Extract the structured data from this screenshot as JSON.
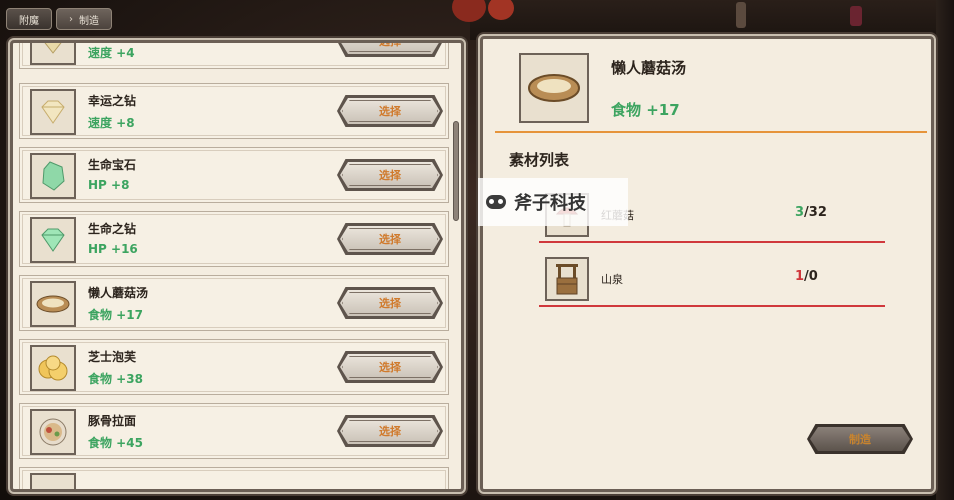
{
  "tabs": [
    {
      "label": "附魔",
      "active": false
    },
    {
      "label": "制造",
      "active": true
    }
  ],
  "list": {
    "items": [
      {
        "name": "",
        "stat": "速度 +4",
        "icon": "gem-icon",
        "select_label": "选择"
      },
      {
        "name": "幸运之钻",
        "stat": "速度 +8",
        "icon": "diamond-icon",
        "select_label": "选择"
      },
      {
        "name": "生命宝石",
        "stat": "HP +8",
        "icon": "green-gem-icon",
        "select_label": "选择"
      },
      {
        "name": "生命之钻",
        "stat": "HP +16",
        "icon": "green-diamond-icon",
        "select_label": "选择"
      },
      {
        "name": "懒人蘑菇汤",
        "stat": "食物 +17",
        "icon": "soup-bowl-icon",
        "select_label": "选择"
      },
      {
        "name": "芝士泡芙",
        "stat": "食物 +38",
        "icon": "cream-puff-icon",
        "select_label": "选择"
      },
      {
        "name": "豚骨拉面",
        "stat": "食物 +45",
        "icon": "ramen-bowl-icon",
        "select_label": "选择"
      },
      {
        "name": "",
        "stat": "",
        "icon": "item-icon",
        "select_label": ""
      }
    ]
  },
  "detail": {
    "title": "懒人蘑菇汤",
    "stat": "食物 +17",
    "icon": "soup-bowl-icon",
    "materials_heading": "素材列表",
    "materials": [
      {
        "name": "红蘑菇",
        "have": "3",
        "need": "/32",
        "have_color": "#3ca460",
        "icon": "mushroom-icon"
      },
      {
        "name": "山泉",
        "have": "1",
        "need": "/0",
        "have_color": "#d0383c",
        "icon": "well-icon"
      }
    ],
    "craft_label": "制造"
  },
  "watermark": {
    "text": "斧子科技"
  },
  "colors": {
    "stat_green": "#3ca460",
    "accent_orange": "#e6943a",
    "line_red": "#d0383c"
  }
}
